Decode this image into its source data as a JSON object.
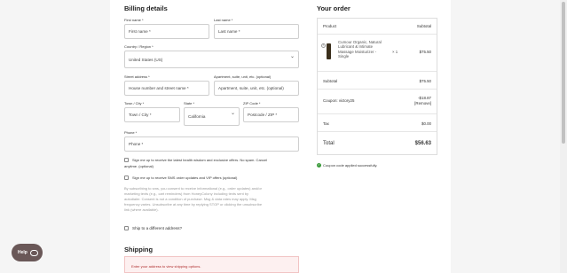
{
  "billing": {
    "title": "Billing details",
    "first_name_label": "First name *",
    "first_name_placeholder": "First name *",
    "last_name_label": "Last name *",
    "last_name_placeholder": "Last name *",
    "country_label": "Country / Region *",
    "country_value": "United States (US)",
    "street_label": "Street address *",
    "street_placeholder": "House number and street name *",
    "apt_label": "Apartment, suite, unit, etc. (optional)",
    "apt_placeholder": "Apartment, suite, unit, etc. (optional)",
    "city_label": "Town / City *",
    "city_placeholder": "Town / City *",
    "state_label": "State *",
    "state_value": "California",
    "zip_label": "ZIP Code *",
    "zip_placeholder": "Postcode / ZIP *",
    "phone_label": "Phone *",
    "phone_placeholder": "Phone *",
    "email_optin_1": "Sign me up to receive the latest health wisdom and exclusive offers. No spam. Cancel",
    "email_optin_2": "anytime. (optional)",
    "sms_optin": "Sign me up to receive SMS order updates and VIP offers (optional)",
    "disclaimer": [
      "By subscribing to sms, you consent to receive informational (e.g., order updates) and/or",
      "marketing texts (e.g., cart reminders) from HoneyColony including texts sent by",
      "autodialer. Consent is not a condition of purchase. Msg & data rates may apply. Msg",
      "frequency varies. Unsubscribe at any time by replying STOP or clicking the unsubscribe",
      "link (where available)."
    ],
    "ship_different": "Ship to a different address?"
  },
  "shipping": {
    "title": "Shipping",
    "notice": "Enter your address to view shipping options."
  },
  "order": {
    "title": "Your order",
    "col_product": "Product",
    "col_subtotal": "Subtotal",
    "item_name": [
      "Cumour Organic, Natural",
      "Lubricant & Intimate",
      "Massage Moisturizer -",
      "Single"
    ],
    "item_qty": "× 1",
    "item_price": "$75.50",
    "subtotal_label": "Subtotal",
    "subtotal_value": "$75.50",
    "coupon_label": "Coupon: victory25",
    "coupon_value": "-$18.87",
    "coupon_remove": "[Remove]",
    "tax_label": "Tax",
    "tax_value": "$0.00",
    "total_label": "Total",
    "total_value": "$56.63",
    "coupon_success": "Coupon code applied successfully."
  },
  "help": {
    "label": "Help"
  }
}
